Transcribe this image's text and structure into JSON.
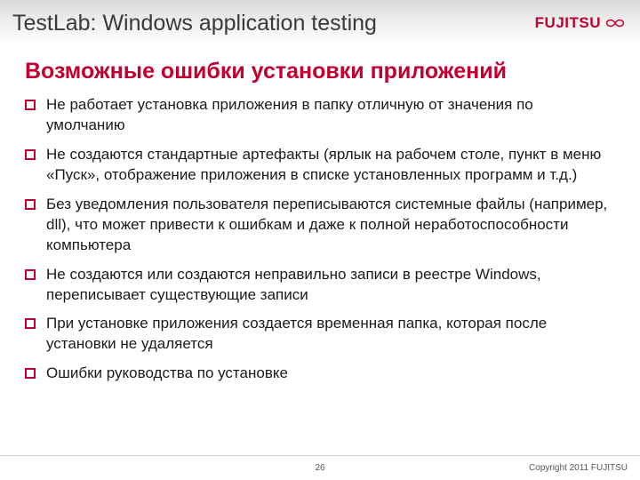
{
  "header": {
    "title": "TestLab: Windows application testing",
    "logo_text": "FUJITSU"
  },
  "section": {
    "title": "Возможные ошибки установки приложений"
  },
  "bullets": [
    "Не работает установка приложения в папку отличную от значения по умолчанию",
    "Не создаются стандартные артефакты (ярлык на рабочем столе, пункт в меню «Пуск», отображение приложения в списке установленных программ и т.д.)",
    "Без уведомления пользователя переписываются системные файлы (например, dll), что может привести к ошибкам и даже к полной неработоспособности компьютера",
    "Не создаются или создаются неправильно записи в реестре Windows, переписывает существующие записи",
    "При установке приложения создается временная папка, которая после установки не удаляется",
    "Ошибки руководства по установке"
  ],
  "footer": {
    "page": "26",
    "copyright": "Copyright 2011 FUJITSU"
  }
}
